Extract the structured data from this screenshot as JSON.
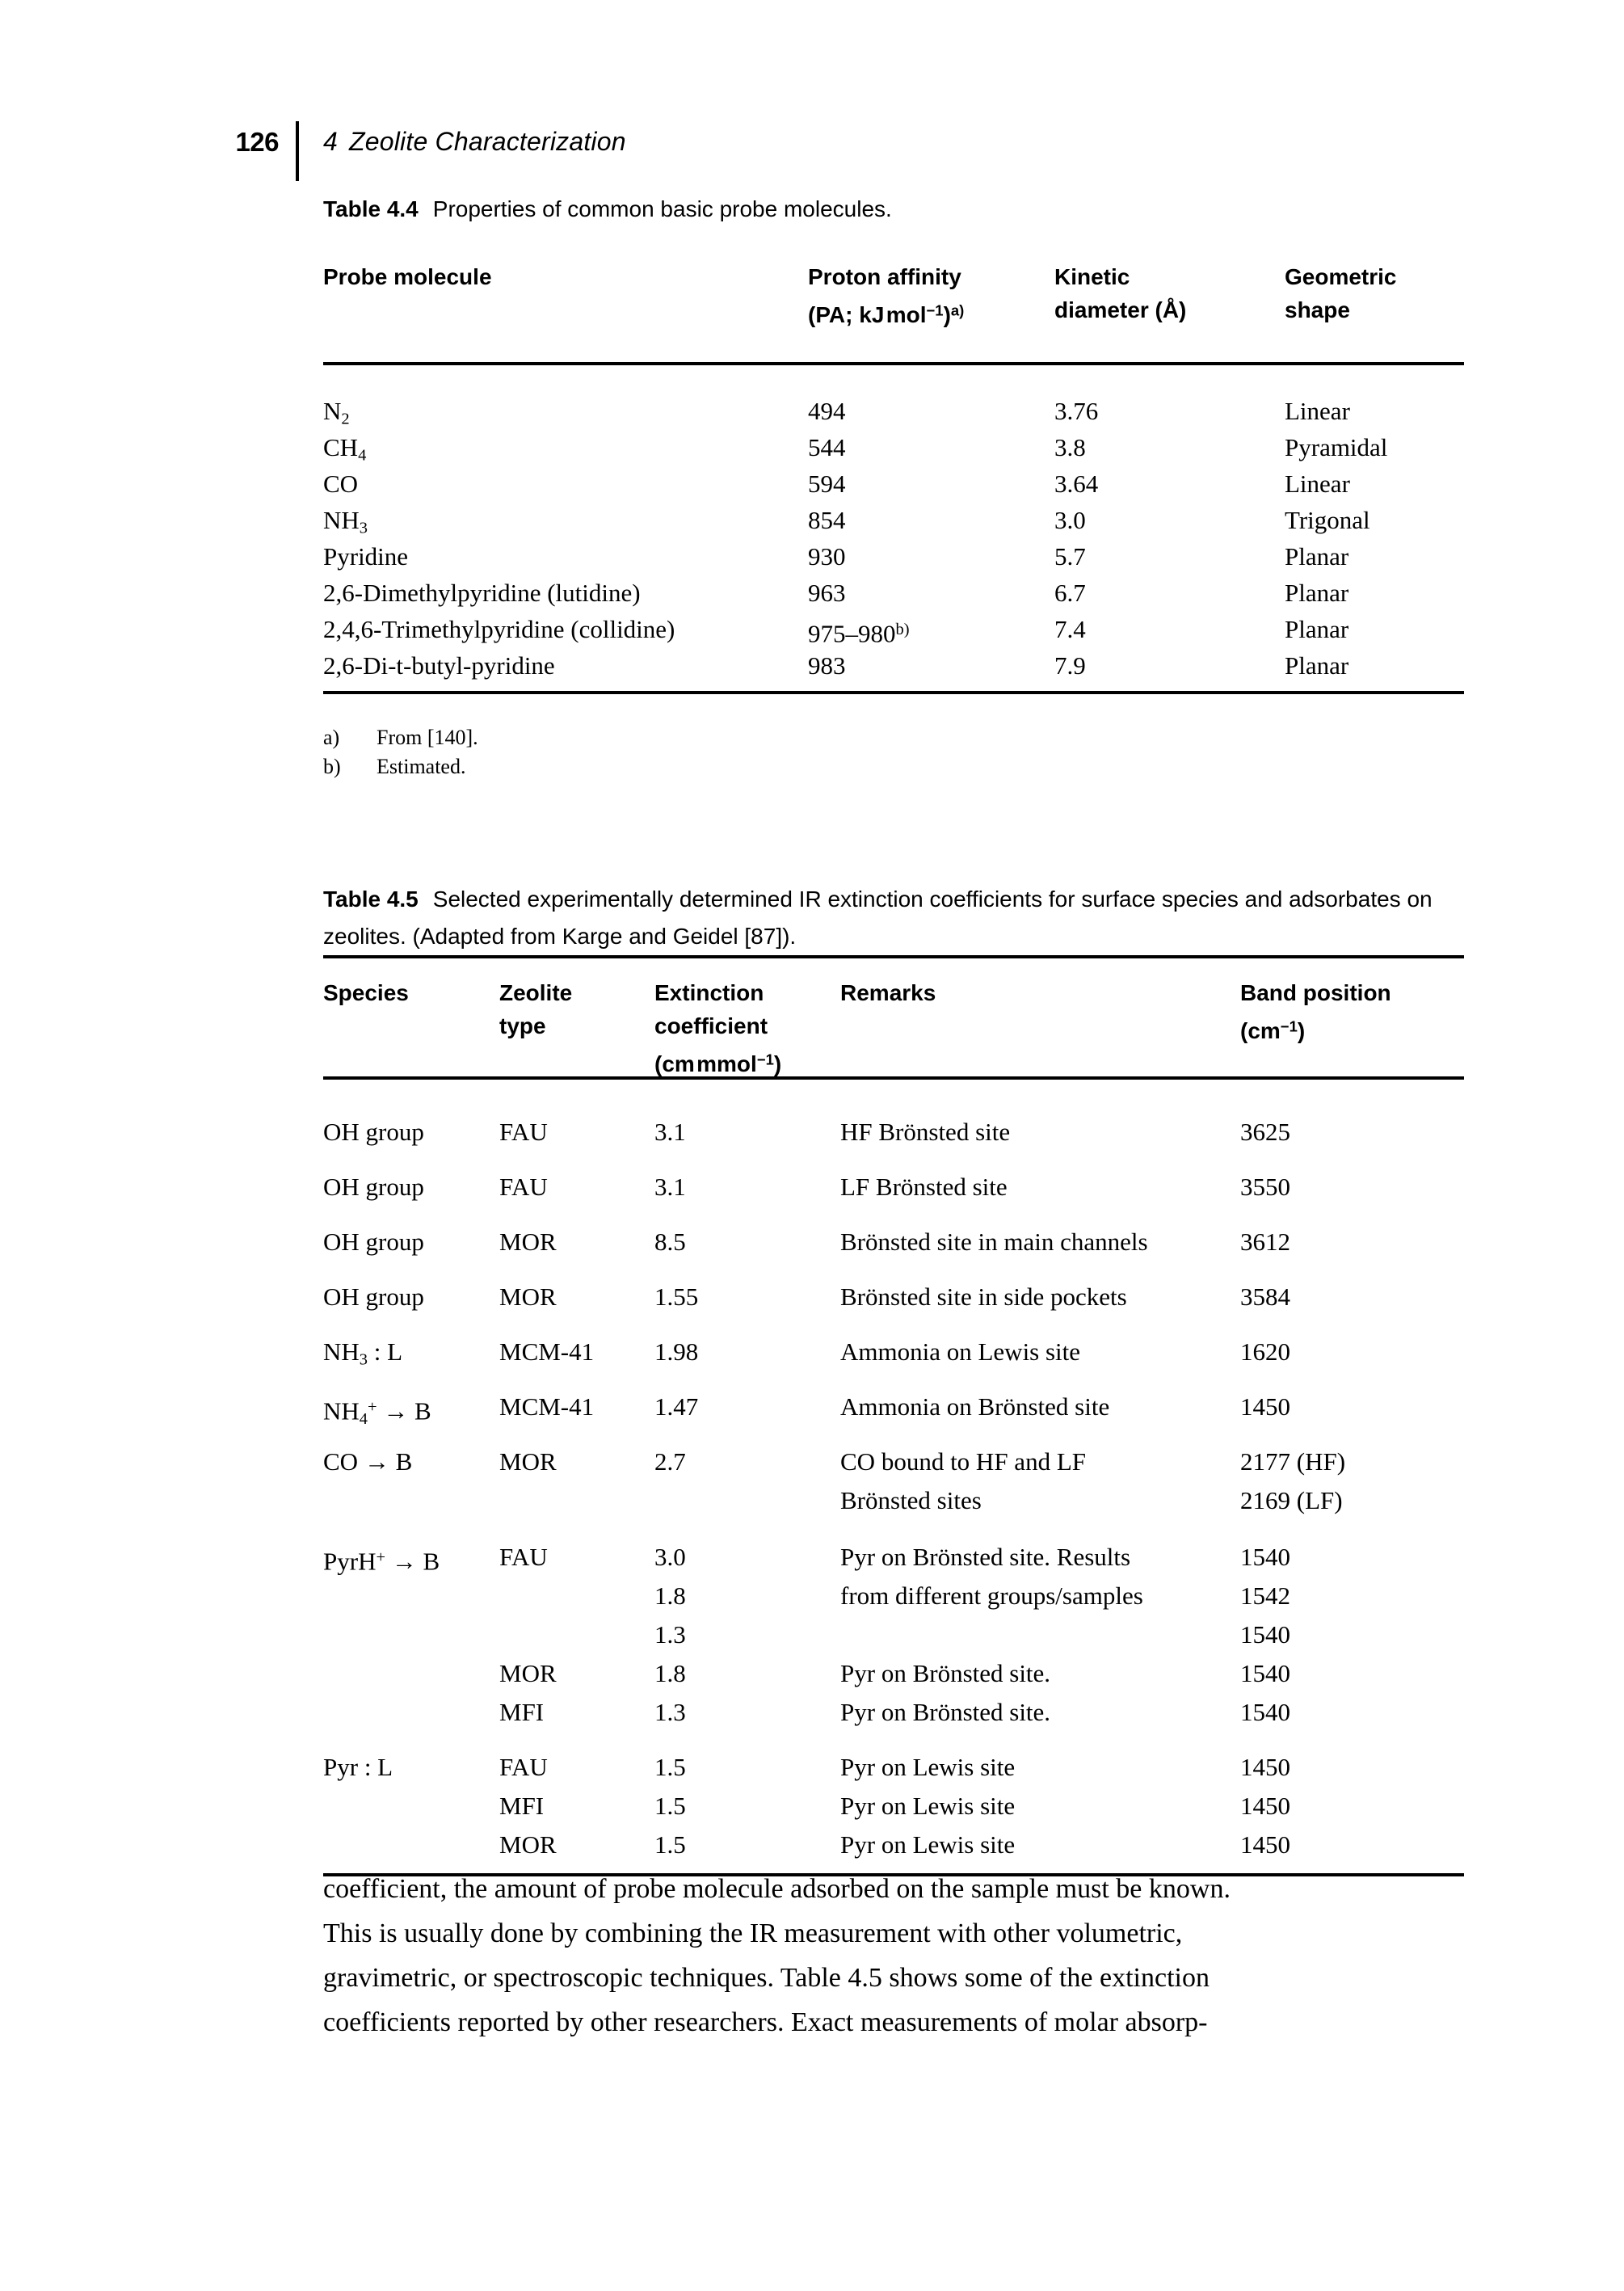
{
  "page": {
    "folio": "126",
    "chapter_number": "4",
    "chapter_title": "Zeolite Characterization"
  },
  "table44": {
    "caption_label": "Table 4.4",
    "caption_text": "Properties of common basic probe molecules.",
    "headers": [
      {
        "line1": "Probe molecule",
        "line2": ""
      },
      {
        "line1": "Proton affinity",
        "line2": "(PA; kJ mol⁻¹)ᵃ⁾"
      },
      {
        "line1": "Kinetic",
        "line2": "diameter (Å)"
      },
      {
        "line1": "Geometric",
        "line2": "shape"
      }
    ],
    "rows": [
      {
        "molecule": "N₂",
        "pa": "494",
        "diameter": "3.76",
        "shape": "Linear"
      },
      {
        "molecule": "CH₄",
        "pa": "544",
        "diameter": "3.8",
        "shape": "Pyramidal"
      },
      {
        "molecule": "CO",
        "pa": "594",
        "diameter": "3.64",
        "shape": "Linear"
      },
      {
        "molecule": "NH₃",
        "pa": "854",
        "diameter": "3.0",
        "shape": "Trigonal"
      },
      {
        "molecule": "Pyridine",
        "pa": "930",
        "diameter": "5.7",
        "shape": "Planar"
      },
      {
        "molecule": "2,6-Dimethylpyridine (lutidine)",
        "pa": "963",
        "diameter": "6.7",
        "shape": "Planar"
      },
      {
        "molecule": "2,4,6-Trimethylpyridine (collidine)",
        "pa": "975–980ᵇ⁾",
        "diameter": "7.4",
        "shape": "Planar"
      },
      {
        "molecule": "2,6-Di-t-butyl-pyridine",
        "pa": "983",
        "diameter": "7.9",
        "shape": "Planar"
      }
    ],
    "footnotes": [
      {
        "mark": "a)",
        "text": "From [140]."
      },
      {
        "mark": "b)",
        "text": "Estimated."
      }
    ]
  },
  "table45": {
    "caption_label": "Table 4.5",
    "caption_line1": "Selected experimentally determined IR extinction coefficients for surface species",
    "caption_line2": "and adsorbates on zeolites. (Adapted from Karge and Geidel [87]).",
    "headers": [
      {
        "line1": "Species",
        "line2": "",
        "line3": ""
      },
      {
        "line1": "Zeolite",
        "line2": "type",
        "line3": ""
      },
      {
        "line1": "Extinction",
        "line2": "coefficient",
        "line3": "(cm mmol⁻¹)"
      },
      {
        "line1": "Remarks",
        "line2": "",
        "line3": ""
      },
      {
        "line1": "Band position",
        "line2": "(cm⁻¹)",
        "line3": ""
      }
    ],
    "rows": [
      {
        "species": "OH group",
        "zeolite": "FAU",
        "coefficient": "3.1",
        "remarks": "HF Brönsted site",
        "band": "3625"
      },
      {
        "species": "OH group",
        "zeolite": "FAU",
        "coefficient": "3.1",
        "remarks": "LF Brönsted site",
        "band": "3550"
      },
      {
        "species": "OH group",
        "zeolite": "MOR",
        "coefficient": "8.5",
        "remarks": "Brönsted site in main channels",
        "band": "3612"
      },
      {
        "species": "OH group",
        "zeolite": "MOR",
        "coefficient": "1.55",
        "remarks": "Brönsted site in side pockets",
        "band": "3584"
      },
      {
        "species": "NH₃ : L",
        "zeolite": "MCM-41",
        "coefficient": "1.98",
        "remarks": "Ammonia on Lewis site",
        "band": "1620"
      },
      {
        "species": "NH₄⁺ → B",
        "zeolite": "MCM-41",
        "coefficient": "1.47",
        "remarks": "Ammonia on Brönsted site",
        "band": "1450"
      },
      {
        "species": "CO → B",
        "zeolite": "MOR",
        "coefficient": "2.7",
        "remarks": "CO bound to HF and LF",
        "band": "2177 (HF)"
      },
      {
        "species": "",
        "zeolite": "",
        "coefficient": "",
        "remarks": "Brönsted sites",
        "band": "2169 (LF)"
      },
      {
        "species": "PyrH⁺ → B",
        "zeolite": "FAU",
        "coefficient": "3.0",
        "remarks": "Pyr on Brönsted site. Results",
        "band": "1540"
      },
      {
        "species": "",
        "zeolite": "",
        "coefficient": "1.8",
        "remarks": "from different groups/samples",
        "band": "1542"
      },
      {
        "species": "",
        "zeolite": "",
        "coefficient": "1.3",
        "remarks": "",
        "band": "1540"
      },
      {
        "species": "",
        "zeolite": "MOR",
        "coefficient": "1.8",
        "remarks": "Pyr on Brönsted site.",
        "band": "1540"
      },
      {
        "species": "",
        "zeolite": "MFI",
        "coefficient": "1.3",
        "remarks": "Pyr on Brönsted site.",
        "band": "1540"
      },
      {
        "species": "Pyr : L",
        "zeolite": "FAU",
        "coefficient": "1.5",
        "remarks": "Pyr on Lewis site",
        "band": "1450"
      },
      {
        "species": "",
        "zeolite": "MFI",
        "coefficient": "1.5",
        "remarks": "Pyr on Lewis site",
        "band": "1450"
      },
      {
        "species": "",
        "zeolite": "MOR",
        "coefficient": "1.5",
        "remarks": "Pyr on Lewis site",
        "band": "1450"
      }
    ]
  },
  "body": {
    "lines": [
      "coefficient, the amount of probe molecule adsorbed on the sample must be known.",
      "This is usually done by combining the IR measurement with other volumetric,",
      "gravimetric, or spectroscopic techniques. Table 4.5 shows some of the extinction",
      "coefficients reported by other researchers. Exact measurements of molar absorp-"
    ]
  }
}
